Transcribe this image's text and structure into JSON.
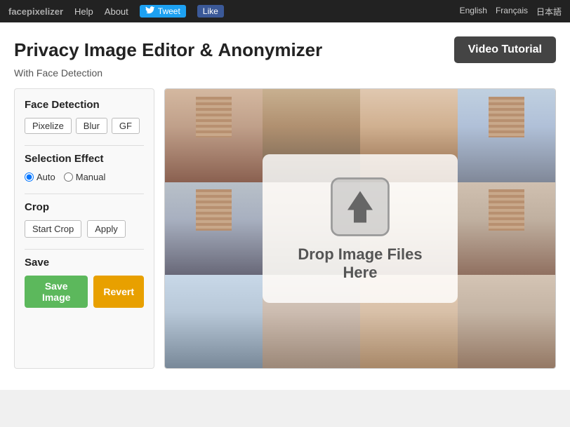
{
  "nav": {
    "brand": "facepixelizer",
    "help": "Help",
    "about": "About",
    "tweet": "Tweet",
    "like": "Like",
    "languages": [
      "English",
      "Français",
      "日本語"
    ]
  },
  "header": {
    "title_part1": "Privacy Image Editor & ",
    "title_part2": "Anonymizer",
    "video_tutorial": "Video Tutorial",
    "subtitle": "With Face Detection"
  },
  "sidebar": {
    "face_detection_label": "Face Detection",
    "effects": [
      {
        "id": "pixelize",
        "label": "Pixelize"
      },
      {
        "id": "blur",
        "label": "Blur"
      },
      {
        "id": "gf",
        "label": "GF"
      }
    ],
    "selection_effect_label": "Selection Effect",
    "radio_auto": "Auto",
    "radio_manual": "Manual",
    "crop_label": "Crop",
    "start_crop": "Start Crop",
    "apply": "Apply",
    "save_label": "Save",
    "save_image": "Save Image",
    "revert": "Revert"
  },
  "dropzone": {
    "drop_text": "Drop Image Files Here"
  },
  "colors": {
    "save_btn": "#5cb85c",
    "revert_btn": "#e8a000",
    "video_btn": "#444444",
    "tw_btn": "#1da1f2",
    "fb_btn": "#3b5998"
  }
}
